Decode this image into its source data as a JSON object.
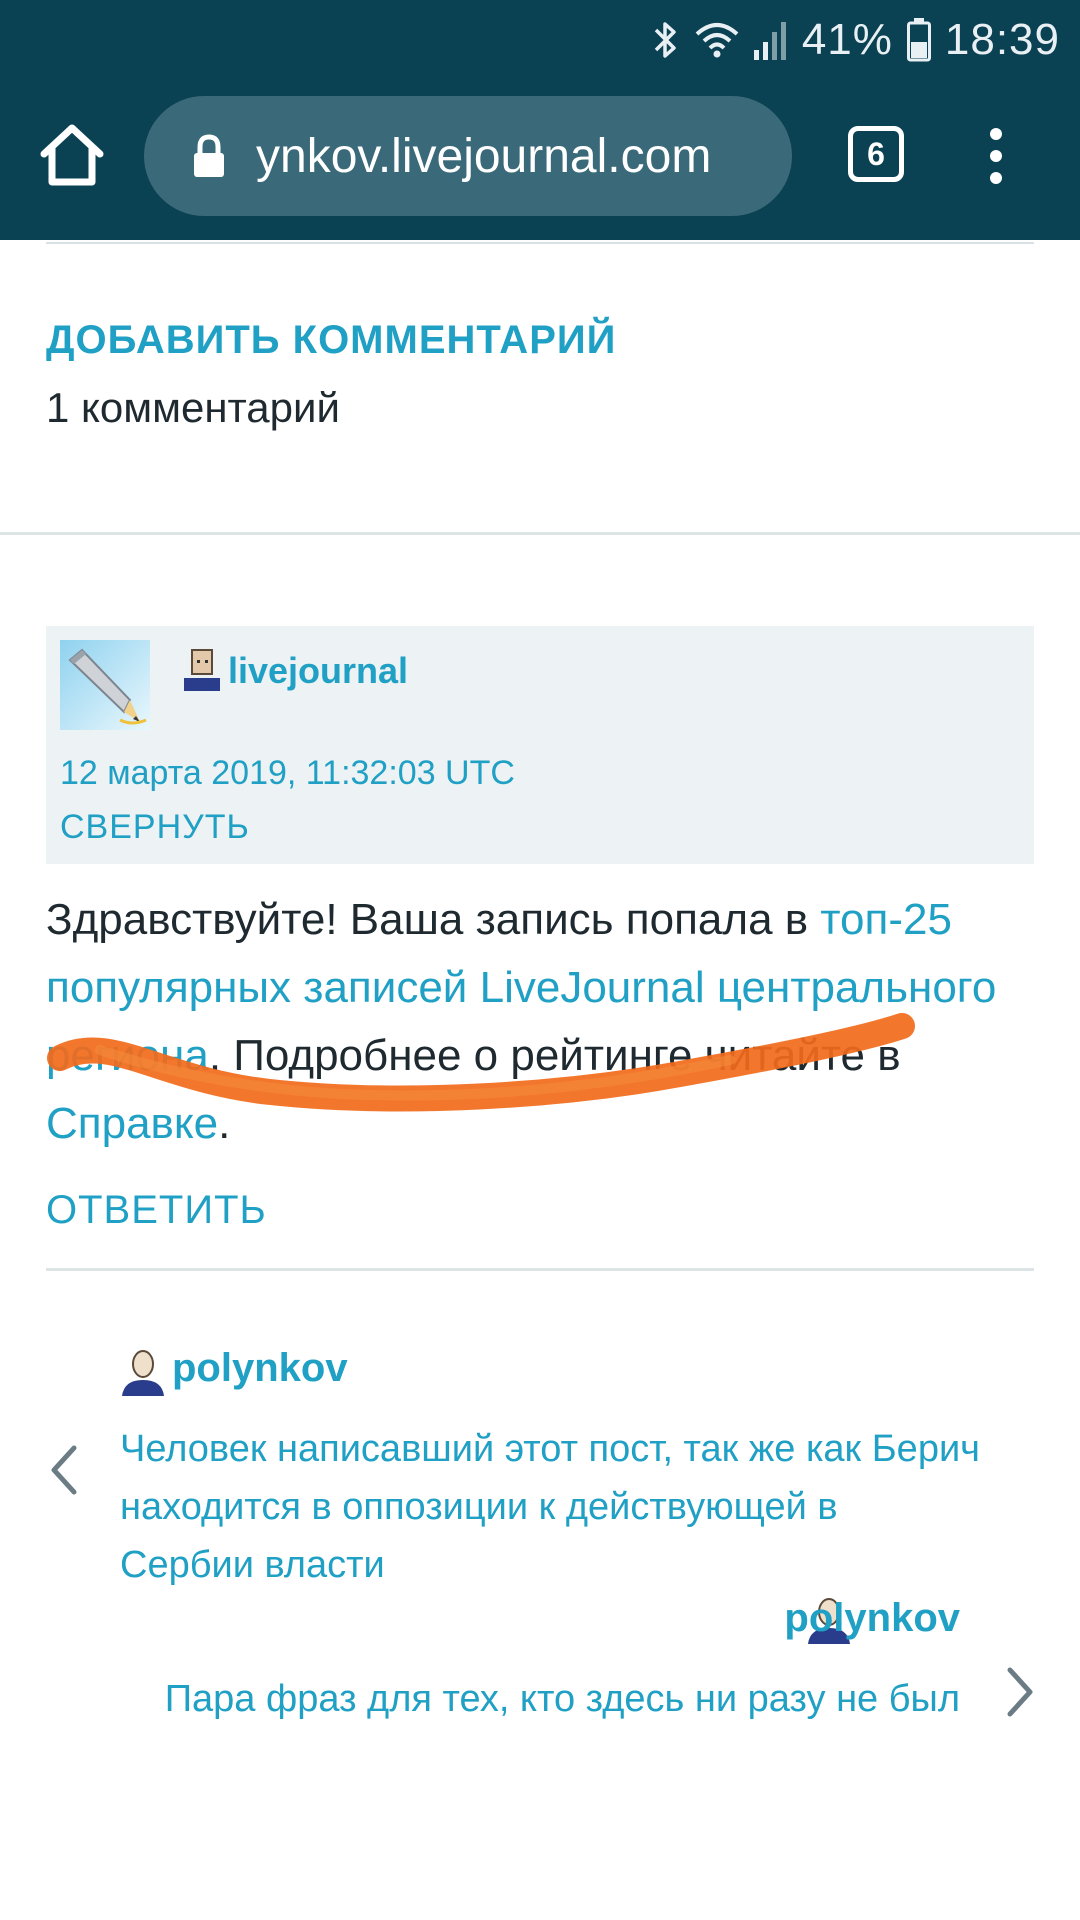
{
  "status_bar": {
    "battery": "41%",
    "time": "18:39"
  },
  "browser": {
    "url": "ynkov.livejournal.com",
    "tab_count": "6"
  },
  "comments_section": {
    "add_comment": "ДОБАВИТЬ КОММЕНТАРИЙ",
    "count_label": "1 комментарий"
  },
  "comment": {
    "author": "livejournal",
    "date": "12 марта 2019, 11:32:03 UTC",
    "collapse": "СВЕРНУТЬ",
    "body": {
      "part1": "Здравствуйте! Ваша запись попала в ",
      "link1": "топ-25 популярных записей LiveJournal центрального региона",
      "part2": ". Подробнее о рейтинге читайте в ",
      "link2": "Справке",
      "part3": "."
    },
    "reply": "ОТВЕТИТЬ"
  },
  "post_nav": {
    "prev": {
      "author": "polynkov",
      "title": "Человек написавший этот пост, так же как Берич находится в оппозиции к действующей в Сербии власти"
    },
    "next": {
      "author": "polynkov",
      "title": "Пара фраз для тех, кто здесь ни разу не был"
    }
  },
  "colors": {
    "toolbar": "#0a4153",
    "url_pill": "#3a6a79",
    "link": "#1fa0c4",
    "text": "#1f2a30",
    "comment_head_bg": "#edf2f4",
    "scribble": "#f26a1b"
  },
  "icons": {
    "bluetooth": "bluetooth-icon",
    "wifi": "wifi-icon",
    "signal": "signal-icon",
    "battery": "battery-icon",
    "home": "home-icon",
    "lock": "lock-icon",
    "menu": "more-vert-icon",
    "userpic": "pencil-userpic-icon",
    "user": "user-icon",
    "prev": "chevron-left-icon",
    "next": "chevron-right-icon"
  }
}
